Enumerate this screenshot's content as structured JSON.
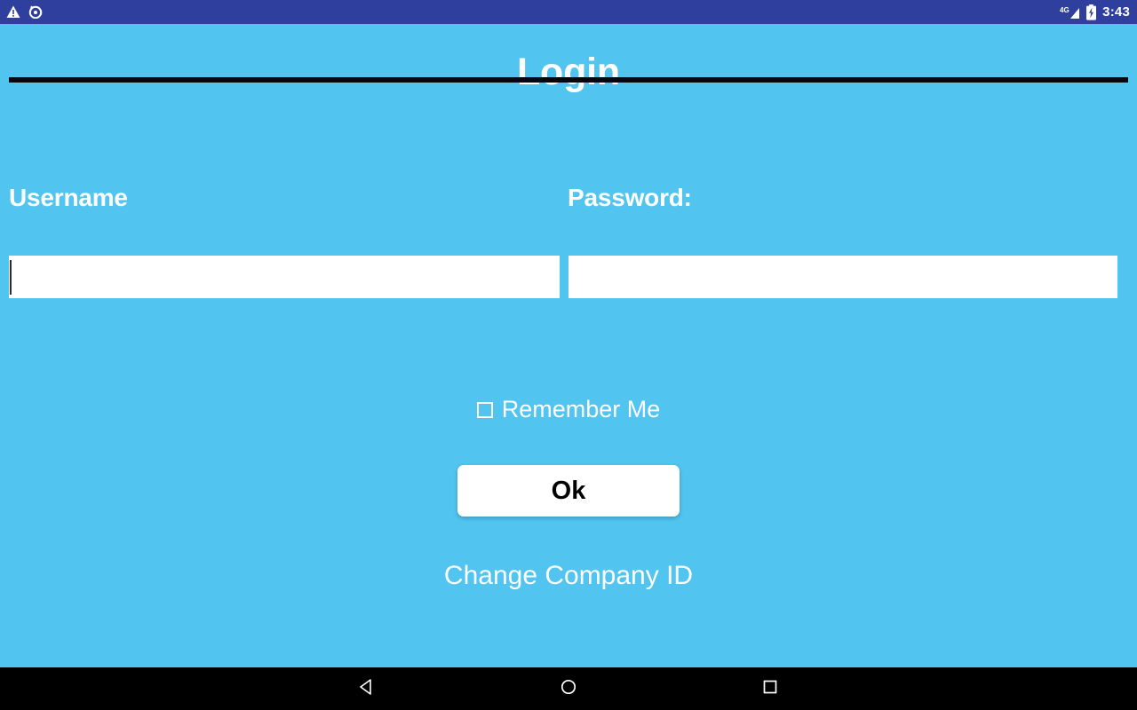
{
  "status_bar": {
    "background_color": "#2e3f9e",
    "notification_icons": [
      {
        "name": "warning-triangle-icon",
        "glyph": "warning"
      },
      {
        "name": "alarm-notification-icon",
        "glyph": "alarm"
      }
    ],
    "network_label": "4G",
    "signal_icon": "signal-bars-icon",
    "battery_icon": "battery-charging-icon",
    "time": "3:43"
  },
  "app": {
    "title": "Login",
    "background_color": "#51c4f0",
    "rule_color": "#05070d",
    "form": {
      "username": {
        "label": "Username",
        "value": "",
        "placeholder": "",
        "focused": true
      },
      "password": {
        "label": "Password:",
        "value": "",
        "placeholder": "",
        "focused": false
      }
    },
    "remember_me": {
      "label": "Remember Me",
      "checked": false
    },
    "submit_button": {
      "label": "Ok"
    },
    "change_company_link": {
      "label": "Change Company ID"
    }
  },
  "nav_bar": {
    "background_color": "#000000",
    "buttons": [
      {
        "name": "back-button",
        "icon": "back-triangle-icon"
      },
      {
        "name": "home-button",
        "icon": "home-circle-icon"
      },
      {
        "name": "recents-button",
        "icon": "recents-square-icon"
      }
    ]
  }
}
